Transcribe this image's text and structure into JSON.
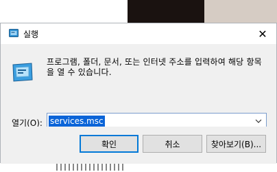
{
  "window": {
    "title": "실행",
    "close_symbol": "✕"
  },
  "description": "프로그램, 폴더, 문서, 또는 인터넷 주소를 입력하여 해당 항목을 열 수 있습니다.",
  "open_field": {
    "label": "열기(O):",
    "value": "services.msc"
  },
  "buttons": {
    "ok": "확인",
    "cancel": "취소",
    "browse": "찾아보기(B)..."
  },
  "icons": {
    "title": "run-icon",
    "main": "run-icon",
    "dropdown": "chevron-down-icon",
    "close": "close-icon"
  },
  "colors": {
    "accent": "#0078d7",
    "selection": "#0a64d8",
    "dialog_bg": "#f0f0f0"
  }
}
